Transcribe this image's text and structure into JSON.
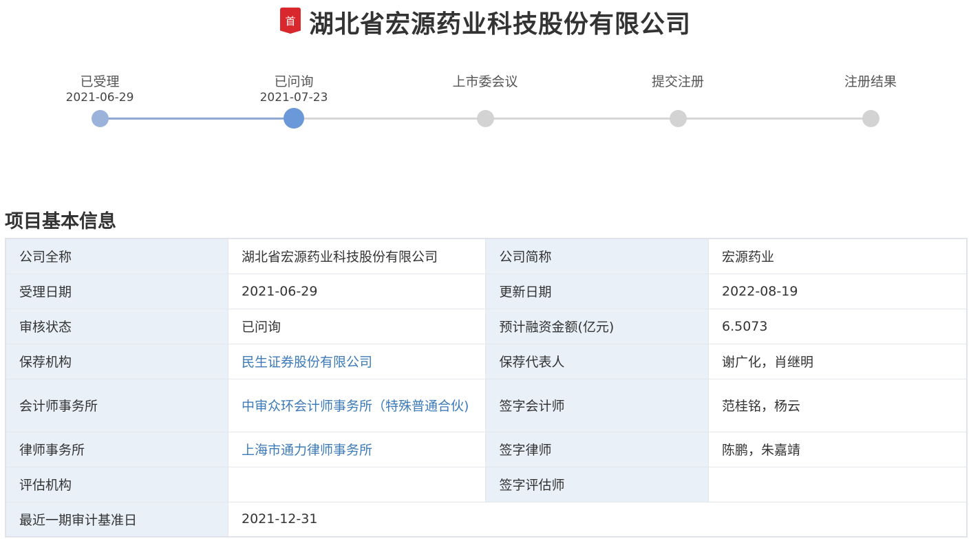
{
  "header": {
    "badge": "首",
    "company_name": "湖北省宏源药业科技股份有限公司"
  },
  "progress": {
    "steps": [
      {
        "label": "已受理",
        "date": "2021-06-29",
        "state": "done"
      },
      {
        "label": "已问询",
        "date": "2021-07-23",
        "state": "current"
      },
      {
        "label": "上市委会议",
        "date": "",
        "state": "pending"
      },
      {
        "label": "提交注册",
        "date": "",
        "state": "pending"
      },
      {
        "label": "注册结果",
        "date": "",
        "state": "pending"
      }
    ],
    "colors": {
      "done": "#9bb3da",
      "current": "#6b98d8",
      "pending": "#d3d3d3"
    }
  },
  "section": {
    "title": "项目基本信息"
  },
  "info": {
    "full_name_label": "公司全称",
    "full_name_value": "湖北省宏源药业科技股份有限公司",
    "short_name_label": "公司简称",
    "short_name_value": "宏源药业",
    "accept_date_label": "受理日期",
    "accept_date_value": "2021-06-29",
    "update_date_label": "更新日期",
    "update_date_value": "2022-08-19",
    "status_label": "审核状态",
    "status_value": "已问询",
    "financing_label": "预计融资金额(亿元)",
    "financing_value": "6.5073",
    "sponsor_label": "保荐机构",
    "sponsor_value": "民生证券股份有限公司",
    "sponsor_rep_label": "保荐代表人",
    "sponsor_rep_value": "谢广化，肖继明",
    "accounting_firm_label": "会计师事务所",
    "accounting_firm_value": "中审众环会计师事务所（特殊普通合伙)",
    "signing_accountant_label": "签字会计师",
    "signing_accountant_value": "范桂铭，杨云",
    "law_firm_label": "律师事务所",
    "law_firm_value": "上海市通力律师事务所",
    "signing_lawyer_label": "签字律师",
    "signing_lawyer_value": "陈鹏，朱嘉靖",
    "appraiser_label": "评估机构",
    "appraiser_value": "",
    "signing_appraiser_label": "签字评估师",
    "signing_appraiser_value": "",
    "audit_date_label": "最近一期审计基准日",
    "audit_date_value": "2021-12-31"
  },
  "link_color": "#3d7ab8"
}
